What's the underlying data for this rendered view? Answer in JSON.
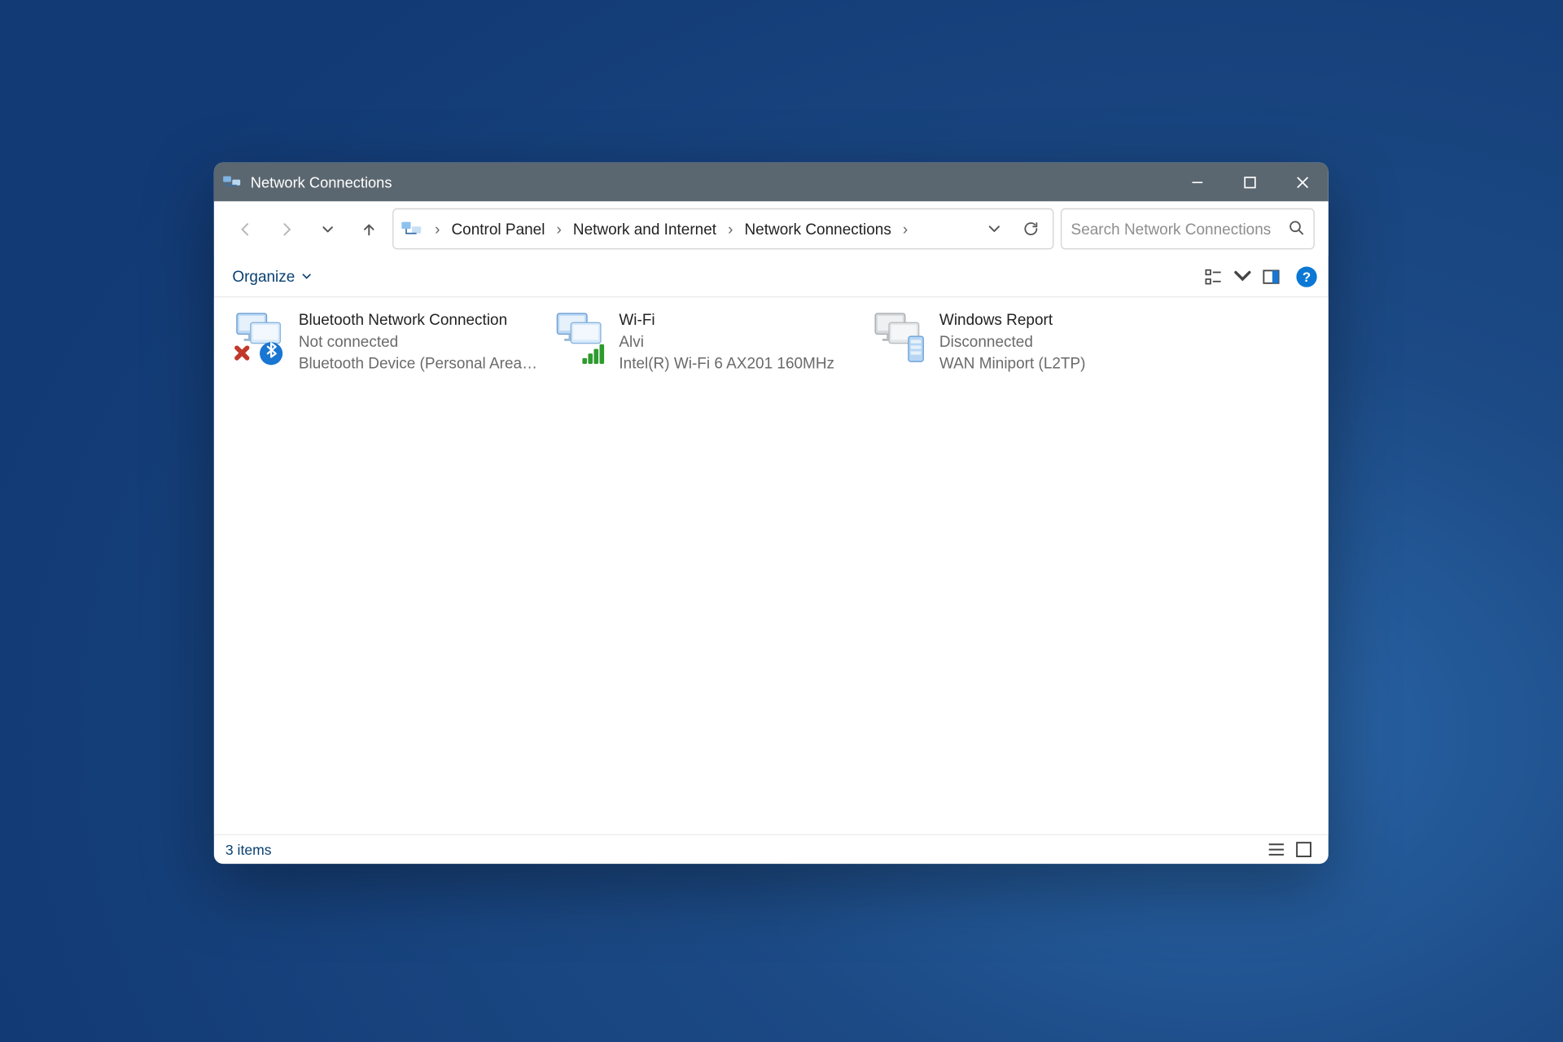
{
  "window": {
    "title": "Network Connections"
  },
  "breadcrumbs": {
    "items": [
      "Control Panel",
      "Network and Internet",
      "Network Connections"
    ]
  },
  "search": {
    "placeholder": "Search Network Connections"
  },
  "toolbar": {
    "organize_label": "Organize"
  },
  "connections": [
    {
      "name": "Bluetooth Network Connection",
      "status": "Not connected",
      "device": "Bluetooth Device (Personal Area ...",
      "icon": "bluetooth"
    },
    {
      "name": "Wi-Fi",
      "status": "Alvi",
      "device": "Intel(R) Wi-Fi 6 AX201 160MHz",
      "icon": "wifi"
    },
    {
      "name": "Windows Report",
      "status": "Disconnected",
      "device": "WAN Miniport (L2TP)",
      "icon": "wan"
    }
  ],
  "status": {
    "text": "3 items"
  }
}
